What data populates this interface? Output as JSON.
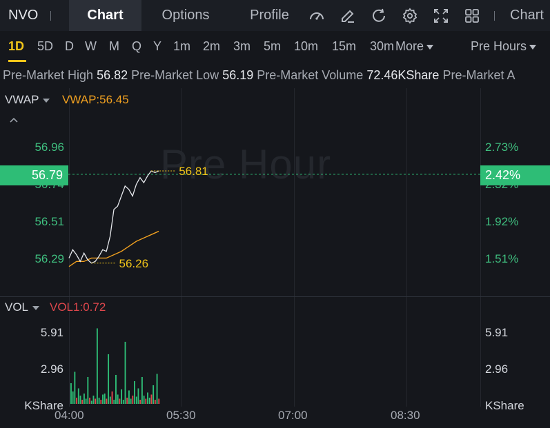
{
  "header": {
    "ticker": "NVO",
    "tabs": [
      {
        "label": "Chart",
        "active": true
      },
      {
        "label": "Options",
        "active": false
      },
      {
        "label": "Profile",
        "active": false
      }
    ],
    "icons": [
      "gauge-icon",
      "edit-icon",
      "refresh-icon",
      "settings-icon",
      "fullscreen-icon",
      "grid-icon"
    ],
    "right_label": "Chart"
  },
  "timeframes": {
    "items": [
      "1D",
      "5D",
      "D",
      "W",
      "M",
      "Q",
      "Y",
      "1m",
      "2m",
      "3m",
      "5m",
      "10m",
      "15m",
      "30m"
    ],
    "active": "1D",
    "more_label": "More",
    "session_label": "Pre Hours"
  },
  "strip": {
    "high_label": "Pre-Market High",
    "high_value": "56.82",
    "low_label": "Pre-Market Low",
    "low_value": "56.19",
    "volume_label": "Pre-Market Volume",
    "volume_value": "72.46KShare",
    "trailing": "Pre-Market A"
  },
  "price_panel": {
    "indicator": "VWAP",
    "indicator_value": "VWAP:56.45",
    "watermark": "Pre Hour",
    "y_left": [
      "56.96",
      "56.74",
      "56.51",
      "56.29"
    ],
    "y_right": [
      "2.73%",
      "2.32%",
      "1.92%",
      "1.51%"
    ],
    "current_price": "56.79",
    "current_pct": "2.42%",
    "high_marker": "56.81",
    "low_marker": "56.26"
  },
  "volume_panel": {
    "indicator": "VOL",
    "indicator_value": "VOL1:0.72",
    "y_left": [
      "5.91",
      "2.96",
      "KShare"
    ],
    "y_right": [
      "5.91",
      "2.96",
      "KShare"
    ]
  },
  "x_axis": [
    "04:00",
    "05:30",
    "07:00",
    "08:30"
  ],
  "colors": {
    "accent": "#f0c419",
    "up": "#2ebd76",
    "down": "#e0474c",
    "vwap": "#f0a020",
    "price_line": "#e6e8ec"
  },
  "chart_data": {
    "type": "line",
    "price": {
      "time": [
        "04:00",
        "04:03",
        "04:06",
        "04:09",
        "04:12",
        "04:15",
        "04:18",
        "04:21",
        "04:24",
        "04:27",
        "04:30",
        "04:33",
        "04:36",
        "04:39",
        "04:42",
        "04:45",
        "04:48",
        "04:51",
        "04:54",
        "04:57",
        "05:00",
        "05:03",
        "05:06",
        "05:09",
        "05:12"
      ],
      "values": [
        56.29,
        56.34,
        56.31,
        56.27,
        56.32,
        56.28,
        56.26,
        56.27,
        56.3,
        56.34,
        56.33,
        56.42,
        56.58,
        56.6,
        56.66,
        56.72,
        56.7,
        56.66,
        56.73,
        56.77,
        56.74,
        56.78,
        56.81,
        56.8,
        56.81
      ]
    },
    "vwap": {
      "time": [
        "04:00",
        "04:06",
        "04:12",
        "04:18",
        "04:24",
        "04:30",
        "04:36",
        "04:42",
        "04:48",
        "04:54",
        "05:00",
        "05:06",
        "05:12"
      ],
      "values": [
        56.24,
        56.27,
        56.27,
        56.29,
        56.29,
        56.29,
        56.31,
        56.33,
        56.36,
        56.39,
        56.41,
        56.43,
        56.45
      ]
    },
    "volume": {
      "values": [
        2.0,
        1.2,
        3.1,
        0.6,
        1.5,
        0.8,
        0.4,
        1.0,
        0.5,
        2.6,
        0.6,
        0.3,
        0.8,
        0.5,
        7.3,
        0.6,
        0.4,
        0.9,
        1.0,
        0.5,
        4.8,
        0.7,
        1.2,
        0.4,
        2.8,
        0.9,
        0.5,
        1.4,
        0.4,
        6.0,
        0.6,
        1.3,
        0.5,
        0.8,
        2.2,
        0.7,
        1.5,
        0.4,
        2.6,
        0.8,
        0.5,
        1.1,
        0.6,
        0.9,
        1.8,
        0.4,
        2.9,
        0.5
      ],
      "up": [
        true,
        true,
        true,
        false,
        true,
        true,
        false,
        true,
        true,
        true,
        false,
        true,
        true,
        false,
        true,
        true,
        false,
        true,
        true,
        false,
        true,
        true,
        false,
        true,
        true,
        true,
        false,
        true,
        true,
        true,
        false,
        true,
        true,
        false,
        true,
        true,
        true,
        false,
        true,
        true,
        false,
        true,
        true,
        false,
        true,
        false,
        true,
        false
      ]
    },
    "price_ylim": [
      56.07,
      57.18
    ],
    "volume_ylim": [
      0,
      8.86
    ],
    "x_range": [
      "04:00",
      "09:30"
    ],
    "grid": true
  }
}
